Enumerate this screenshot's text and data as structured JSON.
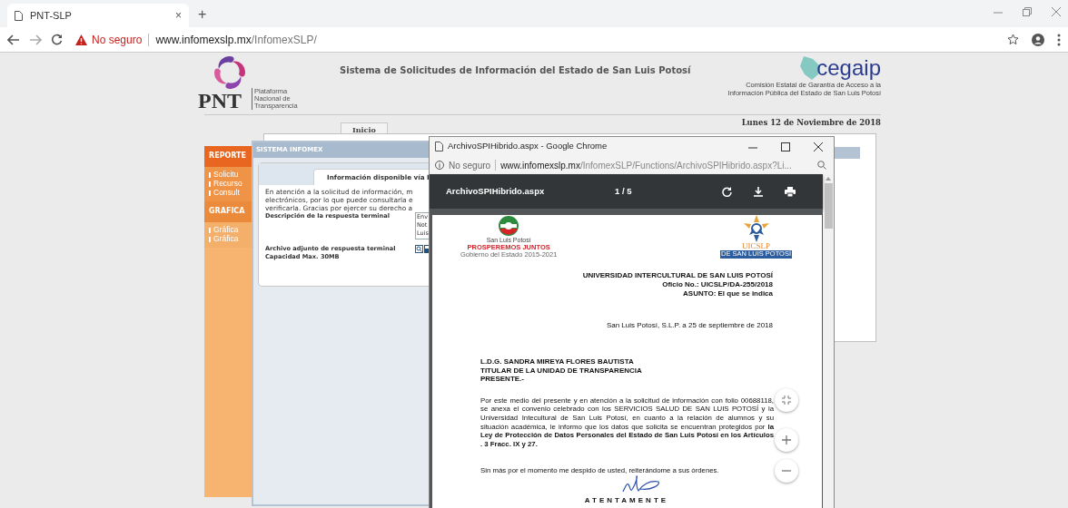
{
  "browser": {
    "tabs": [
      {
        "title": "PNT-SLP",
        "close": "×",
        "selected": true
      }
    ],
    "new_tab": "+",
    "security": "No seguro",
    "url_host": "www.infomexslp.mx",
    "url_path": "/InfomexSLP/"
  },
  "header": {
    "pnt_logo": "PNT",
    "pnt_subtitle_lines": [
      "Plataforma",
      "Nacional de",
      "Transparencia"
    ],
    "title": "Sistema de Solicitudes de Información del Estado de San Luis Potosí",
    "cegaip_logo": "cegaip",
    "cegaip_subtitle_lines": [
      "Comisión Estatal de Garantía de Acceso a la",
      "Información Pública del Estado de San Luis Potosí"
    ],
    "date": "Lunes 12 de Noviembre de 2018"
  },
  "nav_tabs": [
    {
      "label": "Inicio",
      "selected": true
    }
  ],
  "sidebar": {
    "sections": [
      {
        "title": "REPORTE",
        "items": [
          "Solicitu",
          "Recurso",
          "Consult"
        ]
      },
      {
        "title": "GRAFICA",
        "items": [
          "Gráfica",
          "Gráfica"
        ]
      }
    ]
  },
  "dialog": {
    "title": "SISTEMA INFOMEX",
    "tab": "Información disponible vía I",
    "message_lines": [
      "En atención a la solicitud de información, m",
      "electrónicos, por lo que puede consultarla e",
      "verificarla. Gracias por ejercer su derecho a"
    ],
    "description_label": "Descripción de la respuesta terminal",
    "description_lines": [
      "Env",
      "Not",
      "Luis"
    ],
    "attachment_label_lines": [
      "Archivo adjunto de respuesta terminal",
      "Capacidad Max. 30MB"
    ]
  },
  "popup": {
    "title": "ArchivoSPIHibrido.aspx - Google Chrome",
    "security": "No seguro",
    "url_host": "www.infomexslp.mx",
    "url_path": "/InfomexSLP/Functions/ArchivoSPIHibrido.aspx?Li...",
    "pdf": {
      "filename": "ArchivoSPIHibrido.aspx",
      "page": "1 / 5"
    },
    "document": {
      "left_logo": {
        "name": "San Luis Potosí",
        "slogan": "PROSPEREMOS JUNTOS",
        "caption": "Gobierno del Estado 2015-2021"
      },
      "right_logo": {
        "name": "UICSLP",
        "caption": "DE SAN LUIS POTOSÍ"
      },
      "heading_lines": [
        "UNIVERSIDAD INTERCULTURAL DE SAN LUIS POTOSÍ",
        "Oficio No.: UICSLP/DA-255/2018",
        "ASUNTO: El que se indica"
      ],
      "date": "San Luis Potosí, S.L.P. a 25 de septiembre de 2018",
      "addressee_lines": [
        "L.D.G. SANDRA MIREYA FLORES BAUTISTA",
        "TITULAR DE LA UNIDAD DE TRANSPARENCIA",
        "PRESENTE.-"
      ],
      "body": "Por este medio del presente y en atención a la solicitud de información con folio 00688118, se anexa el convenio celebrado con los SERVICIOS SALUD DE SAN LUIS POTOSÍ  y la Universidad Intecultural de San Luis Potosí, en cuanto a la relación de alumnos y su situación académica, le informo que los datos que solicita se encuentran protegidos por **la Ley de Protección de Datos Personales del Estado de San Luis Potosí  en los Artículos . 3 Fracc. IX y 27.**",
      "closing": "Sin más por el momento me despido de usted, reiterándome a sus órdenes.",
      "signoff": "ATENTAMENTE"
    }
  }
}
